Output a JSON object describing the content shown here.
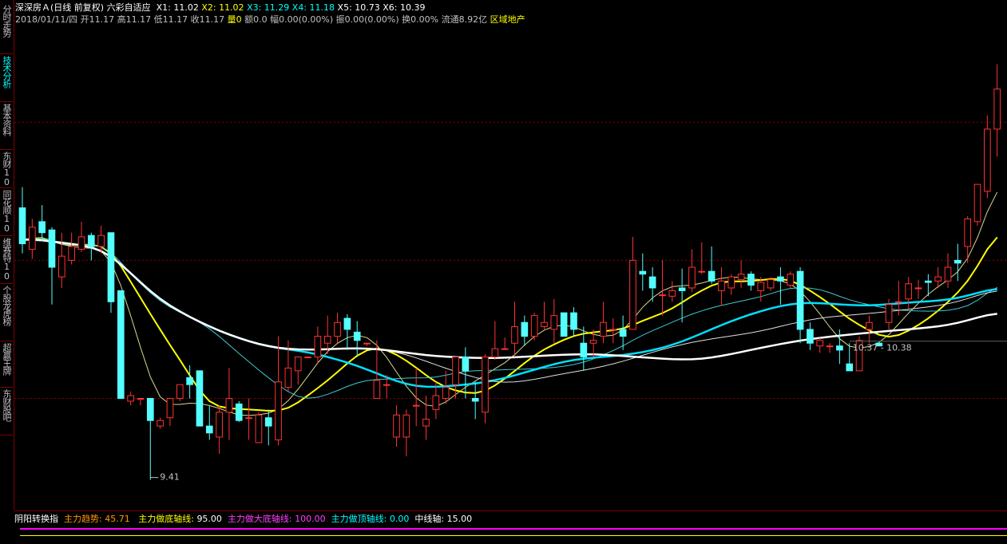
{
  "sidebar": {
    "tabs": [
      {
        "label": "分时走势",
        "active": false
      },
      {
        "label": "技术分析",
        "active": true
      },
      {
        "label": "基本资料",
        "active": false
      },
      {
        "label": "东财10",
        "active": false
      },
      {
        "label": "同花顺10",
        "active": false
      },
      {
        "label": "维赛特10",
        "active": false
      },
      {
        "label": "个股龙虎榜",
        "active": false
      },
      {
        "label": "超赢王牌",
        "active": false
      },
      {
        "label": "东财股吧",
        "active": false
      }
    ]
  },
  "header": {
    "stock": "深深房Ａ",
    "mode": "(日线 前复权)",
    "theme": "六彩自适应",
    "x1": "X1: 11.02",
    "x2": "X2: 11.02",
    "x3": "X3: 11.29",
    "x4": "X4: 11.18",
    "x5": "X5: 10.73",
    "x6": "X6: 10.39"
  },
  "quote": {
    "date": "2018/01/11/四",
    "open": "开11.17",
    "high": "高11.17",
    "low": "低11.17",
    "close": "收11.17",
    "vol_label": "量",
    "vol": "0",
    "amount": "额0.0",
    "change": "幅0.00(0.00%)",
    "amplitude": "振0.00(0.00%)",
    "turnover": "换0.00%",
    "float": "流通8.92亿",
    "sector": "区域地产"
  },
  "chart_data": {
    "type": "candlestick",
    "price_range": [
      9.2,
      12.7
    ],
    "low_label": "9.41",
    "range_label": "10.37 - 10.38",
    "grid_levels": [
      12.0,
      11.0,
      10.0
    ],
    "candles": [
      [
        11.38,
        11.53,
        11.05,
        11.12
      ],
      [
        11.08,
        11.3,
        11.01,
        11.24
      ],
      [
        11.28,
        11.4,
        11.14,
        11.2
      ],
      [
        11.22,
        11.24,
        10.68,
        10.95
      ],
      [
        10.88,
        11.2,
        10.8,
        11.03
      ],
      [
        11.0,
        11.2,
        10.97,
        11.1
      ],
      [
        11.08,
        11.28,
        11.06,
        11.17
      ],
      [
        11.18,
        11.2,
        11.0,
        11.1
      ],
      [
        11.1,
        11.25,
        11.05,
        11.18
      ],
      [
        11.2,
        11.2,
        10.62,
        10.7
      ],
      [
        10.78,
        10.78,
        10.0,
        10.0
      ],
      [
        9.98,
        10.05,
        9.95,
        10.02
      ],
      [
        10.0,
        10.0,
        9.95,
        10.0
      ],
      [
        10.0,
        10.0,
        9.41,
        9.84
      ],
      [
        9.8,
        9.86,
        9.78,
        9.84
      ],
      [
        9.86,
        9.88,
        9.8,
        10.0
      ],
      [
        10.0,
        10.1,
        9.98,
        10.1
      ],
      [
        10.15,
        10.24,
        10.0,
        10.1
      ],
      [
        10.2,
        10.2,
        9.8,
        9.8
      ],
      [
        9.8,
        9.95,
        9.7,
        9.75
      ],
      [
        9.72,
        9.95,
        9.6,
        9.9
      ],
      [
        9.9,
        10.22,
        9.7,
        10.0
      ],
      [
        9.96,
        9.98,
        9.83,
        9.84
      ],
      [
        9.86,
        10.0,
        9.7,
        9.86
      ],
      [
        9.68,
        9.9,
        9.68,
        9.88
      ],
      [
        9.86,
        9.92,
        9.66,
        9.8
      ],
      [
        9.7,
        10.45,
        9.66,
        10.12
      ],
      [
        10.08,
        10.42,
        10.05,
        10.22
      ],
      [
        10.2,
        10.3,
        10.1,
        10.3
      ],
      [
        10.3,
        10.3,
        10.3,
        10.3
      ],
      [
        10.3,
        10.52,
        10.25,
        10.45
      ],
      [
        10.4,
        10.6,
        10.32,
        10.45
      ],
      [
        10.45,
        10.62,
        10.4,
        10.55
      ],
      [
        10.58,
        10.61,
        10.35,
        10.5
      ],
      [
        10.48,
        10.56,
        10.3,
        10.42
      ],
      [
        10.4,
        10.4,
        10.38,
        10.4
      ],
      [
        10.0,
        10.42,
        10.0,
        10.13
      ],
      [
        10.1,
        10.17,
        10.0,
        10.1
      ],
      [
        9.72,
        9.95,
        9.65,
        9.88
      ],
      [
        9.72,
        9.92,
        9.58,
        9.88
      ],
      [
        9.95,
        10.22,
        9.8,
        9.95
      ],
      [
        9.8,
        10.02,
        9.7,
        9.85
      ],
      [
        9.92,
        10.12,
        9.85,
        10.02
      ],
      [
        10.0,
        10.2,
        9.96,
        10.08
      ],
      [
        10.1,
        10.3,
        10.0,
        10.3
      ],
      [
        10.3,
        10.37,
        10.0,
        10.2
      ],
      [
        10.0,
        10.12,
        9.85,
        9.98
      ],
      [
        9.9,
        10.32,
        9.82,
        10.3
      ],
      [
        10.3,
        10.56,
        10.28,
        10.36
      ],
      [
        10.36,
        10.44,
        10.36,
        10.36
      ],
      [
        10.4,
        10.7,
        10.3,
        10.52
      ],
      [
        10.55,
        10.6,
        10.38,
        10.45
      ],
      [
        10.45,
        10.62,
        10.42,
        10.6
      ],
      [
        10.52,
        10.7,
        10.5,
        10.55
      ],
      [
        10.5,
        10.72,
        10.4,
        10.6
      ],
      [
        10.62,
        10.62,
        10.45,
        10.45
      ],
      [
        10.62,
        10.66,
        10.45,
        10.5
      ],
      [
        10.4,
        10.52,
        10.2,
        10.3
      ],
      [
        10.4,
        10.5,
        10.3,
        10.42
      ],
      [
        10.45,
        10.7,
        10.4,
        10.55
      ],
      [
        10.5,
        10.58,
        10.4,
        10.5
      ],
      [
        10.5,
        10.6,
        10.35,
        10.45
      ],
      [
        10.5,
        11.17,
        10.5,
        11.0
      ],
      [
        10.92,
        11.05,
        10.78,
        10.9
      ],
      [
        10.88,
        10.95,
        10.7,
        10.8
      ],
      [
        10.75,
        11.0,
        10.6,
        10.75
      ],
      [
        10.74,
        10.85,
        10.7,
        10.78
      ],
      [
        10.8,
        10.94,
        10.55,
        10.78
      ],
      [
        10.8,
        11.08,
        10.77,
        10.95
      ],
      [
        10.92,
        11.13,
        10.9,
        10.92
      ],
      [
        10.92,
        11.1,
        10.83,
        10.85
      ],
      [
        10.78,
        10.95,
        10.67,
        10.85
      ],
      [
        10.8,
        10.9,
        10.75,
        10.88
      ],
      [
        10.86,
        11.0,
        10.8,
        10.9
      ],
      [
        10.9,
        10.92,
        10.78,
        10.82
      ],
      [
        10.78,
        10.88,
        10.7,
        10.84
      ],
      [
        10.8,
        10.88,
        10.78,
        10.86
      ],
      [
        10.88,
        10.95,
        10.68,
        10.85
      ],
      [
        10.82,
        10.92,
        10.8,
        10.9
      ],
      [
        10.92,
        10.95,
        10.4,
        10.5
      ],
      [
        10.5,
        10.55,
        10.35,
        10.4
      ],
      [
        10.38,
        10.44,
        10.33,
        10.42
      ],
      [
        10.38,
        10.4,
        10.33,
        10.38
      ],
      [
        10.38,
        10.5,
        10.25,
        10.35
      ],
      [
        10.25,
        10.4,
        10.2,
        10.2
      ],
      [
        10.2,
        10.45,
        10.2,
        10.42
      ],
      [
        10.5,
        10.6,
        10.4,
        10.55
      ],
      [
        10.4,
        10.4,
        10.38,
        10.38
      ],
      [
        10.55,
        10.72,
        10.5,
        10.68
      ],
      [
        10.7,
        10.85,
        10.6,
        10.7
      ],
      [
        10.72,
        10.88,
        10.65,
        10.83
      ],
      [
        10.8,
        10.86,
        10.72,
        10.8
      ],
      [
        10.85,
        10.9,
        10.74,
        10.84
      ],
      [
        10.85,
        10.95,
        10.8,
        10.88
      ],
      [
        10.85,
        11.05,
        10.8,
        10.95
      ],
      [
        11.0,
        11.12,
        10.85,
        10.98
      ],
      [
        11.1,
        11.32,
        10.98,
        11.3
      ],
      [
        11.28,
        11.55,
        11.25,
        11.55
      ],
      [
        11.5,
        12.05,
        11.45,
        11.95
      ],
      [
        11.95,
        12.42,
        11.75,
        12.24
      ]
    ]
  },
  "indicator": {
    "name": "阴阳转换指",
    "trend_label": "主力趋势:",
    "trend_value": "45.71",
    "bottom_label": "主力做底轴线:",
    "bottom_value": "95.00",
    "bigbottom_label": "主力做大底轴线:",
    "bigbottom_value": "100.00",
    "top_label": "主力做顶轴线:",
    "top_value": "0.00",
    "mid_label": "中线轴:",
    "mid_value": "15.00"
  }
}
